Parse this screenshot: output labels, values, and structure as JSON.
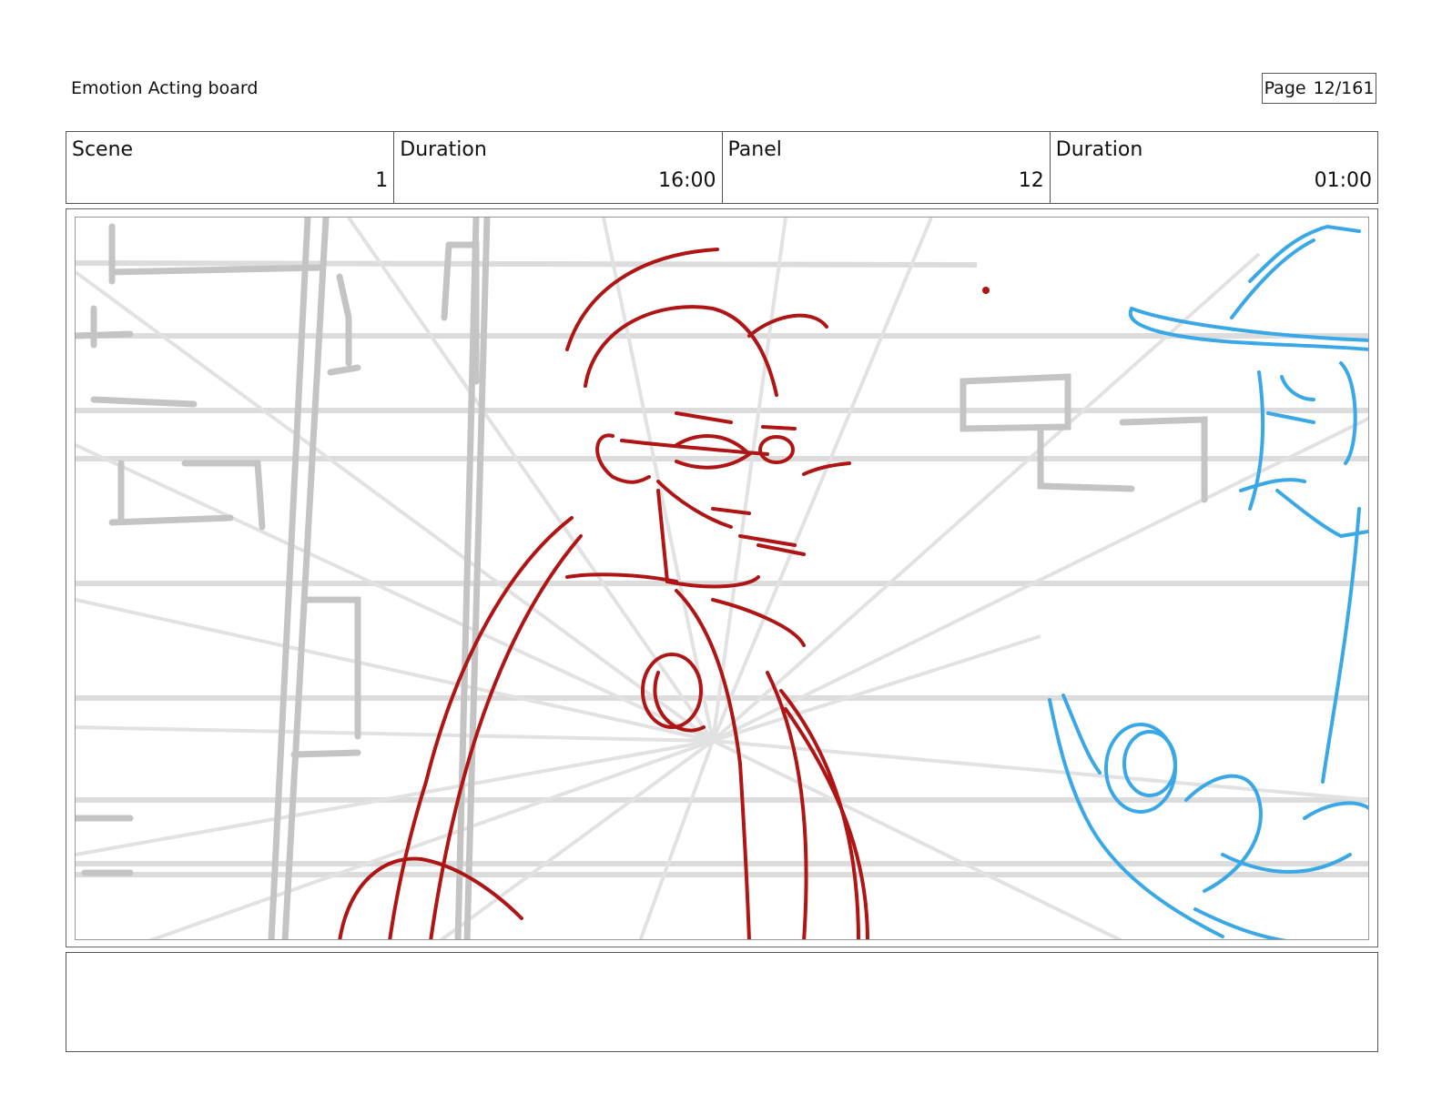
{
  "header": {
    "title": "Emotion Acting board",
    "page_label": "Page",
    "page_value": "12/161"
  },
  "info": [
    {
      "label": "Scene",
      "value": "1"
    },
    {
      "label": "Duration",
      "value": "16:00"
    },
    {
      "label": "Panel",
      "value": "12"
    },
    {
      "label": "Duration",
      "value": "01:00"
    }
  ],
  "panel": {
    "image": "storyboard-sketch",
    "colors": {
      "background_lines": "#d4d4d4",
      "main_character": "#b01515",
      "second_character": "#3aa8e6"
    }
  },
  "notes": {
    "text": ""
  }
}
